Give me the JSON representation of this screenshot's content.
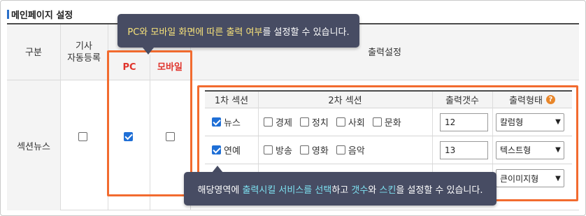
{
  "panel": {
    "title": "메인페이지 설정"
  },
  "header": {
    "category": "구분",
    "auto_article": "기사\n자동등록",
    "pc": "PC",
    "mobile": "모바일",
    "output_settings": "출력설정"
  },
  "row": {
    "label": "섹션뉴스",
    "auto_checked": false,
    "pc_checked": true,
    "mobile_checked": false
  },
  "inner_table": {
    "headers": {
      "first_section": "1차 섹션",
      "second_section": "2차 섹션",
      "output_count": "출력갯수",
      "output_type": "출력형태",
      "help_icon": "?"
    },
    "rows": [
      {
        "first": {
          "label": "뉴스",
          "checked": true
        },
        "second": [
          {
            "label": "경제",
            "checked": false
          },
          {
            "label": "정치",
            "checked": false
          },
          {
            "label": "사회",
            "checked": false
          },
          {
            "label": "문화",
            "checked": false
          }
        ],
        "count": "12",
        "type": "칼럼형"
      },
      {
        "first": {
          "label": "연예",
          "checked": true
        },
        "second": [
          {
            "label": "방송",
            "checked": false
          },
          {
            "label": "영화",
            "checked": false
          },
          {
            "label": "음악",
            "checked": false
          }
        ],
        "count": "13",
        "type": "텍스트형"
      },
      {
        "first": {
          "label": "",
          "checked": false
        },
        "second": [],
        "count": "",
        "type": "큰이미지형"
      }
    ]
  },
  "tooltip_top": {
    "part1": "PC와 모바일 화면에 따른 ",
    "part2": "출력 여부",
    "part3": "를 설정할 수 있습니다."
  },
  "tooltip_bottom": {
    "part1": "해당영역에 ",
    "part2": "출력시킬 서비스를 선택",
    "part3": "하고 ",
    "part4": "갯수",
    "part5": "와 ",
    "part6": "스킨",
    "part7": "을 설정할 수 있습니다."
  },
  "colors": {
    "highlight_border": "#f26b2f",
    "tooltip_bg": "#474c63",
    "checkbox_checked": "#1f6fd6",
    "title_accent": "#2a6fc9",
    "red_label": "#e0332b"
  }
}
